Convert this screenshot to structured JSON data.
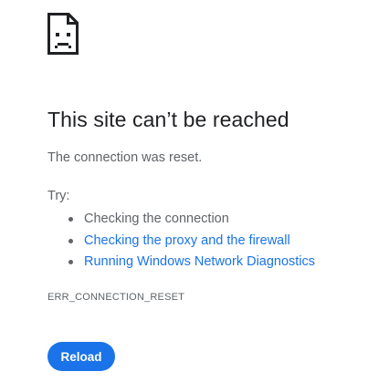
{
  "icon": "sad-file-icon",
  "heading": "This site can’t be reached",
  "summary": "The connection was reset.",
  "try_label": "Try:",
  "suggestions": [
    {
      "text": "Checking the connection",
      "is_link": false
    },
    {
      "text": "Checking the proxy and the firewall",
      "is_link": true
    },
    {
      "text": "Running Windows Network Diagnostics",
      "is_link": true
    }
  ],
  "error_code": "ERR_CONNECTION_RESET",
  "reload_label": "Reload",
  "colors": {
    "link": "#1a73e8",
    "button": "#1a73e8",
    "heading": "#202124",
    "body_text": "#5f6368"
  }
}
